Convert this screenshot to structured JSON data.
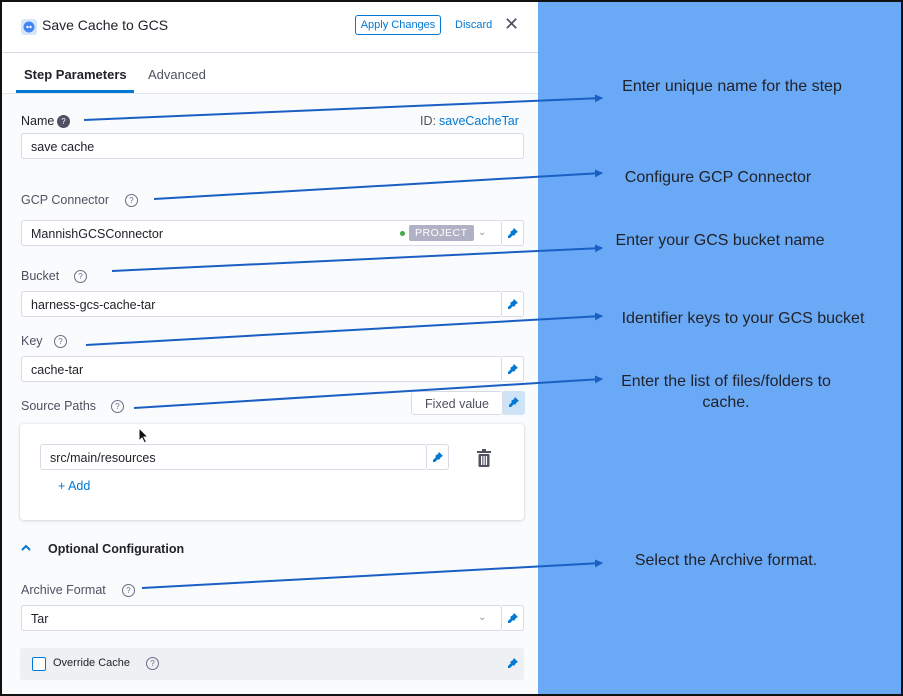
{
  "header": {
    "title": "Save Cache to GCS",
    "apply_label": "Apply Changes",
    "discard_label": "Discard",
    "close_glyph": "✕"
  },
  "tabs": [
    "Step Parameters",
    "Advanced"
  ],
  "form": {
    "name": {
      "label": "Name",
      "value": "save cache",
      "id_prefix": "ID:",
      "id_value": "saveCacheTar"
    },
    "gcp_connector": {
      "label": "GCP Connector",
      "value": "MannishGCSConnector",
      "scope": "PROJECT"
    },
    "bucket": {
      "label": "Bucket",
      "value": "harness-gcs-cache-tar"
    },
    "key": {
      "label": "Key",
      "value": "cache-tar"
    },
    "source_paths": {
      "label": "Source Paths",
      "mode_label": "Fixed value",
      "items": [
        "src/main/resources"
      ],
      "add_label": "+ Add"
    },
    "optional": {
      "title": "Optional Configuration",
      "archive_format": {
        "label": "Archive Format",
        "value": "Tar"
      },
      "override_cache": {
        "label": "Override Cache",
        "checked": false
      }
    }
  },
  "annotations": [
    "Enter unique name for the step",
    "Configure GCP Connector",
    "Enter your GCS bucket name",
    "Identifier keys to your GCS bucket",
    "Enter the list of files/folders to cache.",
    "Select the Archive format."
  ],
  "colors": {
    "accent": "#0278d5",
    "annotation_bg": "#6aa9f6",
    "arrow": "#1a5fc4"
  }
}
